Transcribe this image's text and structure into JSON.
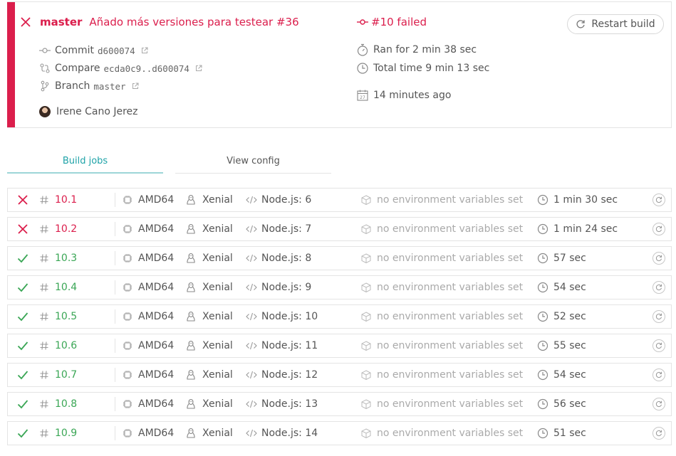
{
  "build": {
    "branch": "master",
    "commit_message": "Añado más versiones para testear #36",
    "status_text": "#10 failed",
    "restart_label": "Restart build",
    "commit_label": "Commit",
    "commit_sha": "d600074",
    "compare_label": "Compare",
    "compare_range": "ecda0c9..d600074",
    "branch_label": "Branch",
    "branch_value": "master",
    "author": "Irene Cano Jerez",
    "ran_for": "Ran for 2 min 38 sec",
    "total_time": "Total time 9 min 13 sec",
    "finished_ago": "14 minutes ago"
  },
  "tabs": {
    "build_jobs": "Build jobs",
    "view_config": "View config"
  },
  "colors": {
    "failed": "#db1e4c",
    "passed": "#3aa655",
    "tab_active": "#1fa3a8"
  },
  "jobs": [
    {
      "status": "failed",
      "number": "10.1",
      "arch": "AMD64",
      "os": "Xenial",
      "language": "Node.js: 6",
      "env": "no environment variables set",
      "duration": "1 min 30 sec"
    },
    {
      "status": "failed",
      "number": "10.2",
      "arch": "AMD64",
      "os": "Xenial",
      "language": "Node.js: 7",
      "env": "no environment variables set",
      "duration": "1 min 24 sec"
    },
    {
      "status": "passed",
      "number": "10.3",
      "arch": "AMD64",
      "os": "Xenial",
      "language": "Node.js: 8",
      "env": "no environment variables set",
      "duration": "57 sec"
    },
    {
      "status": "passed",
      "number": "10.4",
      "arch": "AMD64",
      "os": "Xenial",
      "language": "Node.js: 9",
      "env": "no environment variables set",
      "duration": "54 sec"
    },
    {
      "status": "passed",
      "number": "10.5",
      "arch": "AMD64",
      "os": "Xenial",
      "language": "Node.js: 10",
      "env": "no environment variables set",
      "duration": "52 sec"
    },
    {
      "status": "passed",
      "number": "10.6",
      "arch": "AMD64",
      "os": "Xenial",
      "language": "Node.js: 11",
      "env": "no environment variables set",
      "duration": "55 sec"
    },
    {
      "status": "passed",
      "number": "10.7",
      "arch": "AMD64",
      "os": "Xenial",
      "language": "Node.js: 12",
      "env": "no environment variables set",
      "duration": "54 sec"
    },
    {
      "status": "passed",
      "number": "10.8",
      "arch": "AMD64",
      "os": "Xenial",
      "language": "Node.js: 13",
      "env": "no environment variables set",
      "duration": "56 sec"
    },
    {
      "status": "passed",
      "number": "10.9",
      "arch": "AMD64",
      "os": "Xenial",
      "language": "Node.js: 14",
      "env": "no environment variables set",
      "duration": "51 sec"
    }
  ]
}
